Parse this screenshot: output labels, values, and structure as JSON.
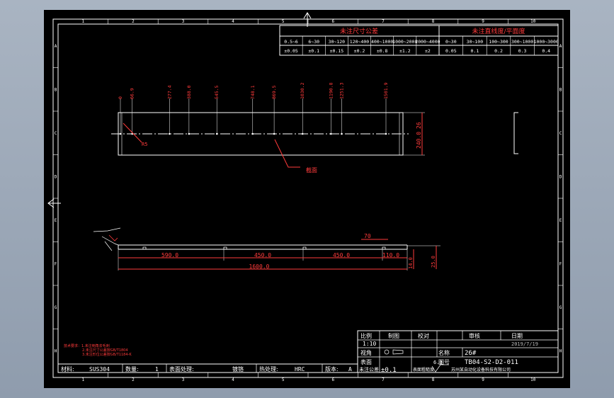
{
  "border": {
    "cols": [
      "1",
      "2",
      "3",
      "4",
      "5",
      "6",
      "7",
      "8",
      "9",
      "10"
    ],
    "rows": [
      "A",
      "B",
      "C",
      "D",
      "E",
      "F",
      "G",
      "H"
    ]
  },
  "tolerance_linear": {
    "title": "未注尺寸公差",
    "ranges": [
      "0.5~6",
      "6~30",
      "30~120",
      "120~400",
      "400~1000",
      "1000~2000",
      "2000~4000"
    ],
    "values": [
      "±0.05",
      "±0.1",
      "±0.15",
      "±0.2",
      "±0.8",
      "±1.2",
      "±2"
    ]
  },
  "tolerance_flat": {
    "title": "未注直线度/平面度",
    "ranges": [
      "0~30",
      "30~100",
      "100~300",
      "300~1000",
      "1000~3000"
    ],
    "values": [
      "0.05",
      "0.1",
      "0.2",
      "0.3",
      "0.4"
    ]
  },
  "top_view": {
    "positions": [
      "0",
      "66.9",
      "277.4",
      "388.0",
      "545.5",
      "748.1",
      "869.5",
      "1030.2",
      "1190.8",
      "1251.3",
      "1501.9"
    ],
    "width_dim": "240.0",
    "small_dim": "26",
    "radius_dim": "R5",
    "note": "截面"
  },
  "side_view": {
    "dims": {
      "d1": "590.0",
      "d2": "450.0",
      "d3": "450.0",
      "d4": "110.0",
      "total": "1600.0",
      "d70": "70",
      "h1": "14.0",
      "h2": "25.0"
    }
  },
  "red_notes": [
    "技术要求：1.未注倒角去毛刺",
    "2.未注尺寸公差按GB/T1804",
    "3.未注形位公差按GB/T1184-K"
  ],
  "title_block": {
    "scale_label": "比例",
    "scale": "1:10",
    "drawn_label": "制图",
    "checked_label": "校对",
    "review_label": "审核",
    "date_label": "日期",
    "date": "2019/7/19",
    "proj_label": "视角",
    "name_label": "名称",
    "name": "26#",
    "surface_label": "表面",
    "drawing_no_label": "图号",
    "drawing_no": "TB04-S2-D2-011",
    "tol_label": "未注公差",
    "tol": "±0.1",
    "rough_label": "表面粗糙度",
    "rough": "6.3",
    "company": "苏州某自动化设备科技有限公司",
    "material_label": "材料:",
    "material": "SUS304",
    "qty_label": "数量:",
    "qty": "1",
    "surface_treat_label": "表面处理:",
    "surface_treat": "镀铬",
    "heat_label": "热处理:",
    "heat": "HRC",
    "version_label": "版本:",
    "version": "A"
  }
}
